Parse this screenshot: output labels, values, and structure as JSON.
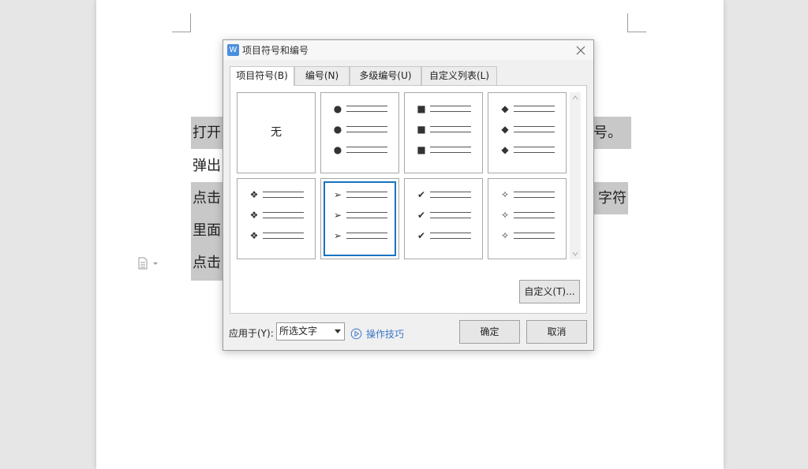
{
  "document": {
    "lines": [
      {
        "left": "打开",
        "right": "号。"
      },
      {
        "left": "弹出",
        "right": ""
      },
      {
        "left": "点击",
        "right": "字符"
      },
      {
        "left": "里面",
        "right": ""
      },
      {
        "left": "点击",
        "right": ""
      }
    ]
  },
  "dialog": {
    "title": "项目符号和编号",
    "app_icon_letter": "W",
    "tabs": [
      {
        "label": "项目符号(B)"
      },
      {
        "label": "编号(N)"
      },
      {
        "label": "多级编号(U)"
      },
      {
        "label": "自定义列表(L)"
      }
    ],
    "bullets": [
      {
        "name": "none",
        "label": "无",
        "glyph": ""
      },
      {
        "name": "filled-circle",
        "glyph": "●"
      },
      {
        "name": "filled-square",
        "glyph": "■"
      },
      {
        "name": "filled-diamond",
        "glyph": "◆"
      },
      {
        "name": "four-diamonds",
        "glyph": "❖"
      },
      {
        "name": "arrowhead",
        "glyph": "➢"
      },
      {
        "name": "checkmark",
        "glyph": "✔"
      },
      {
        "name": "four-point-star",
        "glyph": "✧"
      }
    ],
    "selected_bullet": "arrowhead",
    "customize_label": "自定义(T)...",
    "apply_to_label": "应用于(Y):",
    "apply_to_value": "所选文字",
    "tips_label": "操作技巧",
    "ok_label": "确定",
    "cancel_label": "取消"
  },
  "colors": {
    "selection_border": "#1a73c0",
    "link": "#3b78c8",
    "app_icon": "#4a8fde",
    "highlight": "#c8c8c8"
  }
}
